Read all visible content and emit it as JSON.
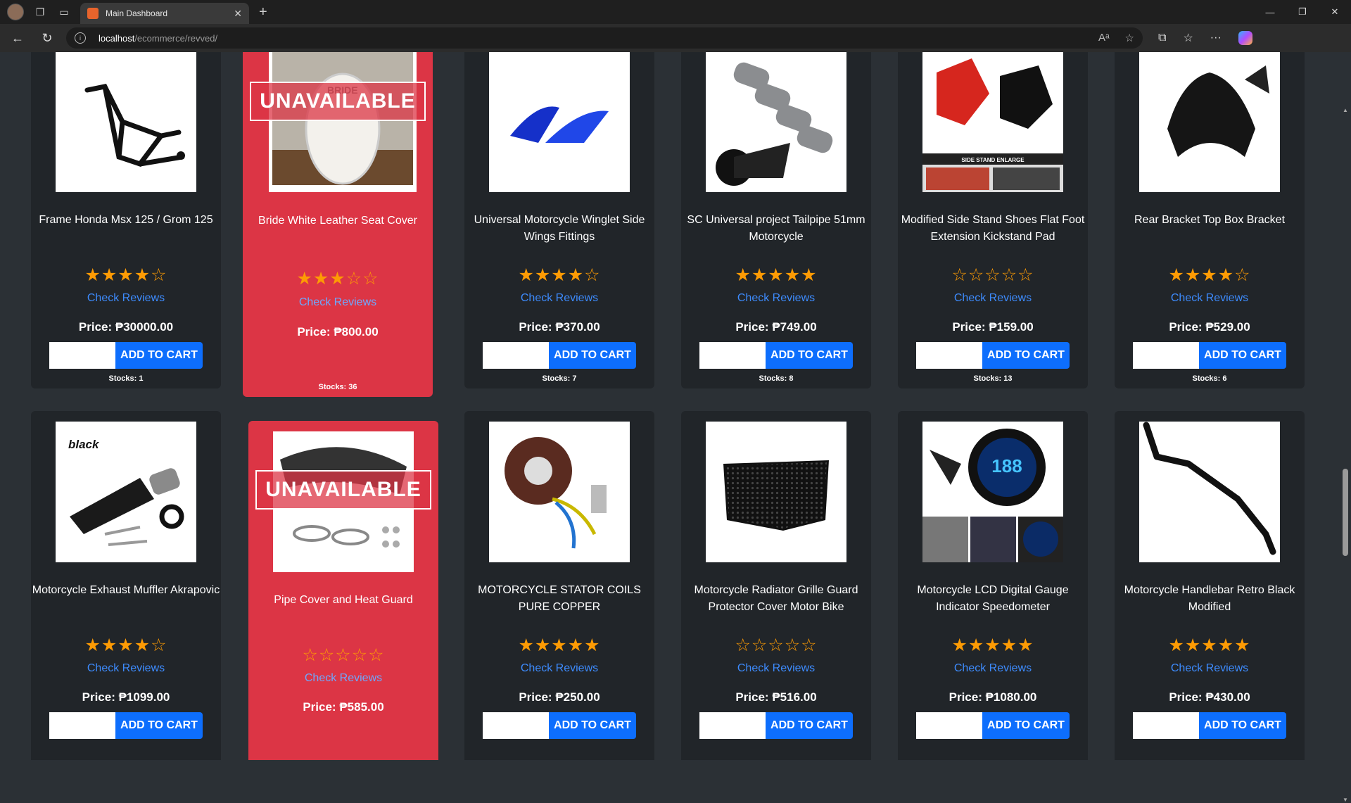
{
  "browser": {
    "tab_title": "Main Dashboard",
    "url_host": "localhost",
    "url_path": "/ecommerce/revved/"
  },
  "colors": {
    "page_bg": "#2b3035",
    "card_bg": "#212529",
    "unavailable_bg": "#dc3545",
    "star": "#fd9b04",
    "link": "#3d8bfd",
    "button": "#0d6efd"
  },
  "labels": {
    "unavailable": "UNAVAILABLE",
    "check_reviews": "Check Reviews",
    "add_to_cart": "ADD TO CART"
  },
  "products_row1": [
    {
      "name": "Frame Honda Msx 125 / Grom 125",
      "rating": 4,
      "price": "Price: ₱30000.00",
      "stocks": "Stocks: 1",
      "available": true,
      "image": "motorcycle-frame"
    },
    {
      "name": "Bride White Leather Seat Cover",
      "rating": 3,
      "price": "Price: ₱800.00",
      "stocks": "Stocks: 36",
      "available": false,
      "image": "seat-cover"
    },
    {
      "name": "Universal Motorcycle Winglet Side Wings Fittings",
      "rating": 4,
      "price": "Price: ₱370.00",
      "stocks": "Stocks: 7",
      "available": true,
      "image": "winglets"
    },
    {
      "name": "SC Universal project Tailpipe 51mm Motorcycle",
      "rating": 5,
      "price": "Price: ₱749.00",
      "stocks": "Stocks: 8",
      "available": true,
      "image": "tailpipe"
    },
    {
      "name": "Modified Side Stand Shoes Flat Foot Extension Kickstand Pad",
      "rating": 0,
      "price": "Price: ₱159.00",
      "stocks": "Stocks: 13",
      "available": true,
      "image": "kickstand-pad"
    },
    {
      "name": "Rear Bracket Top Box Bracket",
      "rating": 4,
      "price": "Price: ₱529.00",
      "stocks": "Stocks: 6",
      "available": true,
      "image": "rear-bracket"
    }
  ],
  "products_row2": [
    {
      "name": "Motorcycle Exhaust Muffler Akrapovic",
      "rating": 4,
      "price": "Price: ₱1099.00",
      "available": true,
      "image": "exhaust-muffler",
      "image_text": "black"
    },
    {
      "name": "Pipe Cover and Heat Guard",
      "rating": 0,
      "price": "Price: ₱585.00",
      "available": false,
      "image": "heat-guard"
    },
    {
      "name": "MOTORCYCLE STATOR COILS PURE COPPER",
      "rating": 5,
      "price": "Price: ₱250.00",
      "available": true,
      "image": "stator-coil"
    },
    {
      "name": "Motorcycle Radiator Grille Guard Protector Cover Motor Bike",
      "rating": 0,
      "price": "Price: ₱516.00",
      "available": true,
      "image": "radiator-grille"
    },
    {
      "name": "Motorcycle LCD Digital Gauge Indicator Speedometer",
      "rating": 5,
      "price": "Price: ₱1080.00",
      "available": true,
      "image": "lcd-gauge",
      "image_text": "188"
    },
    {
      "name": "Motorcycle Handlebar Retro Black Modified",
      "rating": 5,
      "price": "Price: ₱430.00",
      "available": true,
      "image": "handlebar"
    }
  ]
}
